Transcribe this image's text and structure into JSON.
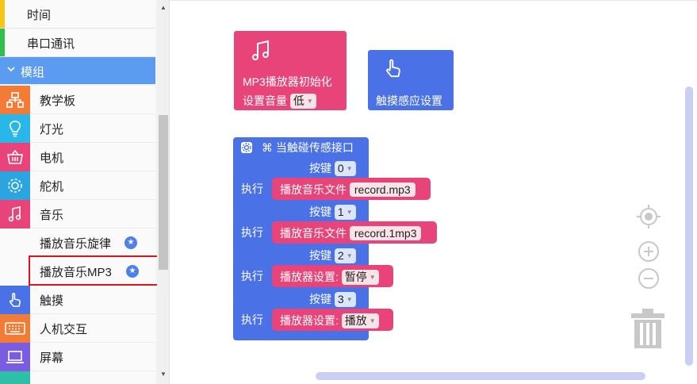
{
  "sidebar": {
    "categories": [
      {
        "label": "时间",
        "color": "#f5c518"
      },
      {
        "label": "串口通讯",
        "color": "#2fbf4a"
      }
    ],
    "module_header": "模组",
    "items": [
      {
        "label": "教学板",
        "icon": "circuit-board-icon",
        "color": "#f27b35"
      },
      {
        "label": "灯光",
        "icon": "lightbulb-icon",
        "color": "#29b6e8"
      },
      {
        "label": "电机",
        "icon": "motor-basket-icon",
        "color": "#e8447a"
      },
      {
        "label": "舵机",
        "icon": "gear-icon",
        "color": "#2aa5e0"
      },
      {
        "label": "音乐",
        "icon": "music-note-icon",
        "color": "#e8447a"
      }
    ],
    "sub_items": [
      {
        "label": "播放音乐旋律"
      },
      {
        "label": "播放音乐MP3"
      }
    ],
    "items_after": [
      {
        "label": "触摸",
        "icon": "touch-hand-icon",
        "color": "#4a72e6"
      },
      {
        "label": "人机交互",
        "icon": "keyboard-icon",
        "color": "#f27b35"
      },
      {
        "label": "屏幕",
        "icon": "laptop-icon",
        "color": "#7a5ce0"
      }
    ]
  },
  "flyout": {
    "mp3_init": {
      "title": "MP3播放器初始化",
      "volume_label": "设置音量",
      "volume_value": "低",
      "icon": "music-note-icon",
      "color": "#e8447a"
    },
    "touch_setup": {
      "title": "触摸感应设置",
      "icon": "touch-hand-icon",
      "color": "#4a72e6"
    }
  },
  "main_block": {
    "header": "当触碰传感接口",
    "header_icon": "command-icon",
    "settings_icon": "gear-icon",
    "key_label": "按键",
    "exec_label": "执行",
    "rows": [
      {
        "key": "0",
        "action": "播放音乐文件",
        "value": "record.mp3",
        "type": "string"
      },
      {
        "key": "1",
        "action": "播放音乐文件",
        "value": "record.1mp3",
        "type": "string"
      },
      {
        "key": "2",
        "action": "播放器设置:",
        "value": "暂停",
        "type": "dropdown"
      },
      {
        "key": "3",
        "action": "播放器设置:",
        "value": "播放",
        "type": "dropdown"
      }
    ]
  },
  "controls": {
    "recenter": "crosshair-icon",
    "zoom_in": "zoom-in-icon",
    "zoom_out": "zoom-out-icon",
    "trash": "trash-icon"
  }
}
